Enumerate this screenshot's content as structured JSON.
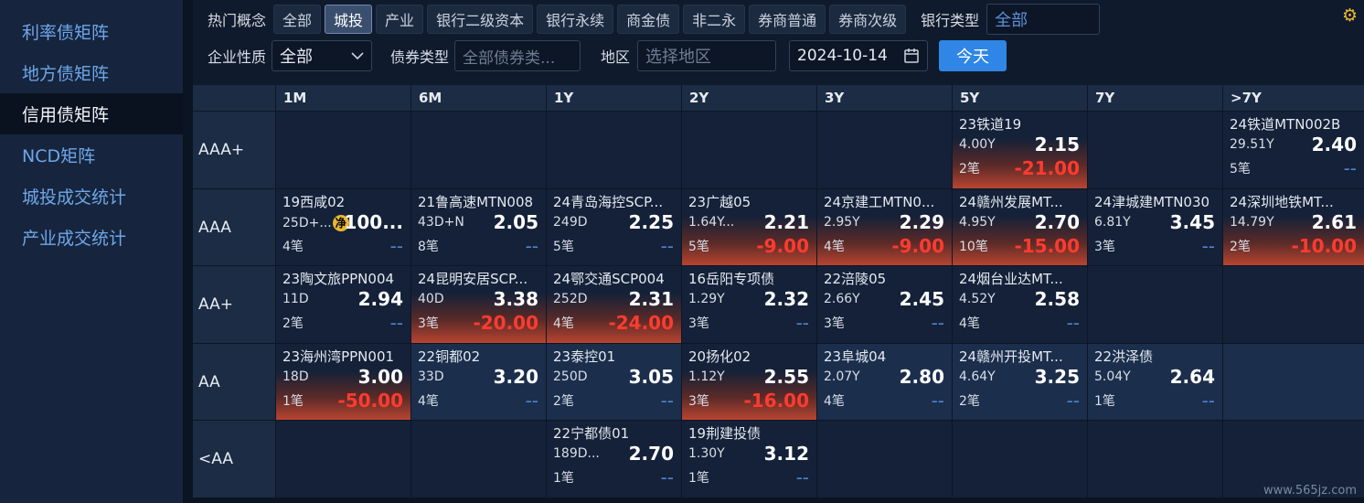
{
  "sidebar": {
    "items": [
      {
        "label": "利率债矩阵",
        "active": false
      },
      {
        "label": "地方债矩阵",
        "active": false
      },
      {
        "label": "信用债矩阵",
        "active": true
      },
      {
        "label": "NCD矩阵",
        "active": false
      },
      {
        "label": "城投成交统计",
        "active": false
      },
      {
        "label": "产业成交统计",
        "active": false
      }
    ]
  },
  "filters": {
    "hot_label": "热门概念",
    "tags": [
      "全部",
      "城投",
      "产业",
      "银行二级资本",
      "银行永续",
      "商金债",
      "非二永",
      "券商普通",
      "券商次级"
    ],
    "active_tag": "城投",
    "bank_type_label": "银行类型",
    "bank_type_value": "全部",
    "enterprise_label": "企业性质",
    "enterprise_value": "全部",
    "bond_type_label": "债券类型",
    "bond_type_placeholder": "全部债券类...",
    "region_label": "地区",
    "region_placeholder": "选择地区",
    "date_value": "2024-10-14",
    "today_label": "今天"
  },
  "icons": {
    "settings": "gear-icon",
    "calendar": "calendar-icon",
    "chevron": "chevron-down-icon",
    "badge_text": "净"
  },
  "colors": {
    "accent": "#2f86e6",
    "negative": "#ff3b2f",
    "gear": "#e8b830"
  },
  "matrix": {
    "columns": [
      "1M",
      "6M",
      "1Y",
      "2Y",
      "3Y",
      "5Y",
      "7Y",
      ">7Y"
    ],
    "rows": [
      {
        "label": "AAA+",
        "cells": [
          null,
          null,
          null,
          null,
          null,
          {
            "name": "23铁道19",
            "term": "4.00Y",
            "yield": "2.15",
            "count": "2笔",
            "change": "-21.00",
            "neg": true
          },
          null,
          {
            "name": "24铁道MTN002B",
            "term": "29.51Y",
            "yield": "2.40",
            "count": "5笔",
            "change": "--",
            "neg": false
          }
        ]
      },
      {
        "label": "AAA",
        "cells": [
          {
            "name": "19西咸02",
            "term": "25D+...",
            "yield": "100...",
            "count": "4笔",
            "change": "--",
            "neg": false,
            "badge": true
          },
          {
            "name": "21鲁高速MTN008",
            "term": "43D+N",
            "yield": "2.05",
            "count": "8笔",
            "change": "--",
            "neg": false
          },
          {
            "name": "24青岛海控SCP...",
            "term": "249D",
            "yield": "2.25",
            "count": "5笔",
            "change": "--",
            "neg": false
          },
          {
            "name": "23广越05",
            "term": "1.64Y...",
            "yield": "2.21",
            "count": "5笔",
            "change": "-9.00",
            "neg": true
          },
          {
            "name": "24京建工MTN0...",
            "term": "2.95Y",
            "yield": "2.29",
            "count": "4笔",
            "change": "-9.00",
            "neg": true
          },
          {
            "name": "24赣州发展MT...",
            "term": "4.95Y",
            "yield": "2.70",
            "count": "10笔",
            "change": "-15.00",
            "neg": true
          },
          {
            "name": "24津城建MTN030",
            "term": "6.81Y",
            "yield": "3.45",
            "count": "3笔",
            "change": "--",
            "neg": false
          },
          {
            "name": "24深圳地铁MT...",
            "term": "14.79Y",
            "yield": "2.61",
            "count": "2笔",
            "change": "-10.00",
            "neg": true
          }
        ]
      },
      {
        "label": "AA+",
        "cells": [
          {
            "name": "23陶文旅PPN004",
            "term": "11D",
            "yield": "2.94",
            "count": "2笔",
            "change": "--",
            "neg": false
          },
          {
            "name": "24昆明安居SCP...",
            "term": "40D",
            "yield": "3.38",
            "count": "3笔",
            "change": "-20.00",
            "neg": true
          },
          {
            "name": "24鄂交通SCP004",
            "term": "252D",
            "yield": "2.31",
            "count": "4笔",
            "change": "-24.00",
            "neg": true
          },
          {
            "name": "16岳阳专项债",
            "term": "1.29Y",
            "yield": "2.32",
            "count": "3笔",
            "change": "--",
            "neg": false
          },
          {
            "name": "22涪陵05",
            "term": "2.66Y",
            "yield": "2.45",
            "count": "3笔",
            "change": "--",
            "neg": false
          },
          {
            "name": "24烟台业达MT...",
            "term": "4.52Y",
            "yield": "2.58",
            "count": "4笔",
            "change": "--",
            "neg": false
          },
          null,
          null
        ]
      },
      {
        "label": "AA",
        "cells": [
          {
            "name": "23海州湾PPN001",
            "term": "18D",
            "yield": "3.00",
            "count": "1笔",
            "change": "-50.00",
            "neg": true
          },
          {
            "name": "22铜都02",
            "term": "33D",
            "yield": "3.20",
            "count": "4笔",
            "change": "--",
            "neg": false
          },
          {
            "name": "23泰控01",
            "term": "250D",
            "yield": "3.05",
            "count": "2笔",
            "change": "--",
            "neg": false
          },
          {
            "name": "20扬化02",
            "term": "1.12Y",
            "yield": "2.55",
            "count": "3笔",
            "change": "-16.00",
            "neg": true
          },
          {
            "name": "23阜城04",
            "term": "2.07Y",
            "yield": "2.80",
            "count": "4笔",
            "change": "--",
            "neg": false
          },
          {
            "name": "24赣州开投MT...",
            "term": "4.64Y",
            "yield": "3.25",
            "count": "2笔",
            "change": "--",
            "neg": false
          },
          {
            "name": "22洪泽债",
            "term": "5.04Y",
            "yield": "2.64",
            "count": "1笔",
            "change": "--",
            "neg": false
          },
          null
        ]
      },
      {
        "label": "<AA",
        "cells": [
          null,
          null,
          {
            "name": "22宁都债01",
            "term": "189D...",
            "yield": "2.70",
            "count": "1笔",
            "change": "--",
            "neg": false
          },
          {
            "name": "19荆建投债",
            "term": "1.30Y",
            "yield": "3.12",
            "count": "1笔",
            "change": "--",
            "neg": false
          },
          null,
          null,
          null,
          null
        ]
      }
    ]
  },
  "watermark": "www.565jz.com"
}
